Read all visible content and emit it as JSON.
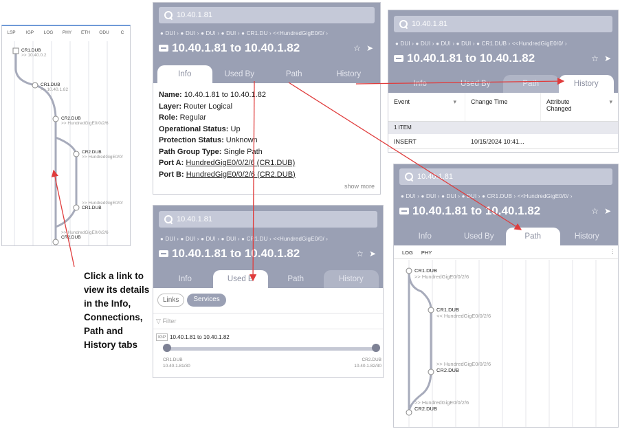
{
  "path_topology": {
    "tabs": [
      "LSP",
      "IGP",
      "LOG",
      "PHY",
      "ETH",
      "ODU",
      "C"
    ],
    "nodes": [
      {
        "label": "CR1.DUB",
        "sub": ">> 10.40.0.2"
      },
      {
        "label": "CR1.DUB",
        "sub": ">> 10.40.1.82"
      },
      {
        "label": "CR2.DUB",
        "sub": ">> HundredGigE0/0/2/6"
      },
      {
        "label": "CR2.DUB",
        "sub": ">> HundredGigE0/0/"
      },
      {
        "label": "CR1.DUB",
        "sub": ">> HundredGigE0/0/"
      },
      {
        "label": "CR2.DUB",
        "sub": ">> HundredGigE0/0/2/6"
      }
    ]
  },
  "info_panel": {
    "search": "10.40.1.81",
    "crumbs": "● DUI › ● DUI › ● DUI › ● DUI › ● CR1.DU › <<HundredGigE0/0/ ›",
    "title": "10.40.1.81 to 10.40.1.82",
    "tabs": [
      "Info",
      "Used By",
      "Path",
      "History"
    ],
    "fields": [
      {
        "label": "Name:",
        "value": "10.40.1.81 to 10.40.1.82"
      },
      {
        "label": "Layer:",
        "value": "Router Logical"
      },
      {
        "label": "Role:",
        "value": "Regular"
      },
      {
        "label": "Operational Status:",
        "value": "Up"
      },
      {
        "label": "Protection Status:",
        "value": "Unknown"
      },
      {
        "label": "Path Group Type:",
        "value": "Single Path"
      },
      {
        "label": "Port A:",
        "value": "HundredGigE0/0/2/6 (CR1.DUB)"
      },
      {
        "label": "Port B:",
        "value": "HundredGigE0/0/2/6 (CR2.DUB)"
      }
    ],
    "show_more": "show more"
  },
  "history_panel": {
    "search": "10.40.1.81",
    "crumbs": "● DUI › ● DUI › ● DUI › ● DUI › ● CR1.DUB › <<HundredGigE0/0/ ›",
    "title": "10.40.1.81 to 10.40.1.82",
    "tabs": [
      "Info",
      "Used By",
      "Path",
      "History"
    ],
    "columns": [
      "Event",
      "Change Time",
      "Attribute Changed"
    ],
    "group": "1 ITEM",
    "row": {
      "event": "INSERT",
      "time": "10/15/2024 10:41..."
    }
  },
  "usedby_panel": {
    "search": "10.40.1.81",
    "crumbs": "● DUI › ● DUI › ● DUI › ● DUI › ● CR1.DU › <<HundredGigE0/0/ ›",
    "title": "10.40.1.81 to 10.40.1.82",
    "tabs": [
      "Info",
      "Used B",
      "Path",
      "History"
    ],
    "chips": [
      "Links",
      "Services"
    ],
    "filter": "Filter",
    "item_tag": "IGP",
    "item_label": "10.40.1.81 to 10.40.1.82",
    "left_end": "CR1.DUB",
    "left_ip": "10.40.1.81/30",
    "right_end": "CR2.DUB",
    "right_ip": "10.40.1.82/30"
  },
  "path_panel": {
    "search": "10.40.1.81",
    "crumbs": "● DUI › ● DUI › ● DUI › ● DUI › ● CR1.DUB › <<HundredGigE0/0/ ›",
    "title": "10.40.1.81 to 10.40.1.82",
    "tabs": [
      "Info",
      "Used By",
      "Path",
      "History"
    ],
    "subtabs": [
      "LOG",
      "PHY"
    ],
    "nodes": [
      {
        "label": "CR1.DUB",
        "sub": ">> HundredGigE0/0/2/6"
      },
      {
        "label": "CR1.DUB",
        "sub": "<< HundredGigE0/0/2/6"
      },
      {
        "label": "CR2.DUB",
        "sub": ">> HundredGigE0/0/2/6"
      },
      {
        "label": "CR2.DUB",
        "sub": ">> HundredGigE0/0/2/6"
      }
    ]
  },
  "annotation": "Click a link to view its details in the Info, Connections, Path and History tabs",
  "colors": {
    "header": "#9aa0b4",
    "arrow": "#e03c3c"
  }
}
